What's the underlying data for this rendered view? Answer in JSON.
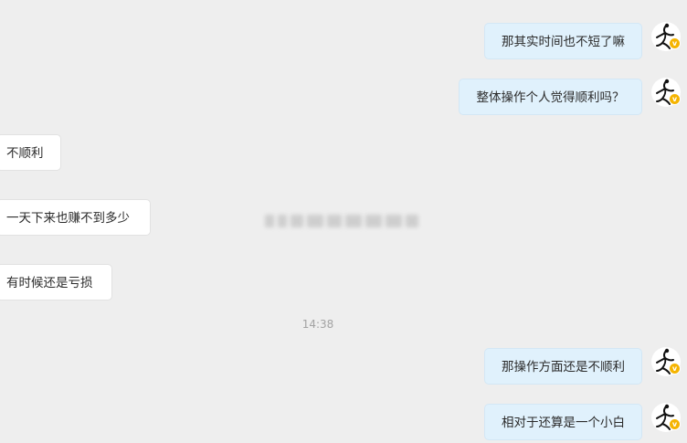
{
  "messages": [
    {
      "side": "out",
      "text": "那其实时间也不短了嘛"
    },
    {
      "side": "out",
      "text": "整体操作个人觉得顺利吗？"
    },
    {
      "side": "in",
      "text": "不顺利"
    },
    {
      "side": "in",
      "text": "一天下来也赚不到多少"
    },
    {
      "side": "in",
      "text": "有时候还是亏损"
    },
    {
      "side": "out",
      "text": "那操作方面还是不顺利"
    },
    {
      "side": "out",
      "text": "相对于还算是一个小白"
    }
  ],
  "timestamp": "14:38",
  "avatar": {
    "icon": "user-avatar-icon",
    "badge_icon": "verified-badge-icon",
    "badge_color": "#f5b400"
  },
  "colors": {
    "background": "#eeeeee",
    "outgoing_bubble": "#e0f1fc",
    "incoming_bubble": "#ffffff"
  }
}
